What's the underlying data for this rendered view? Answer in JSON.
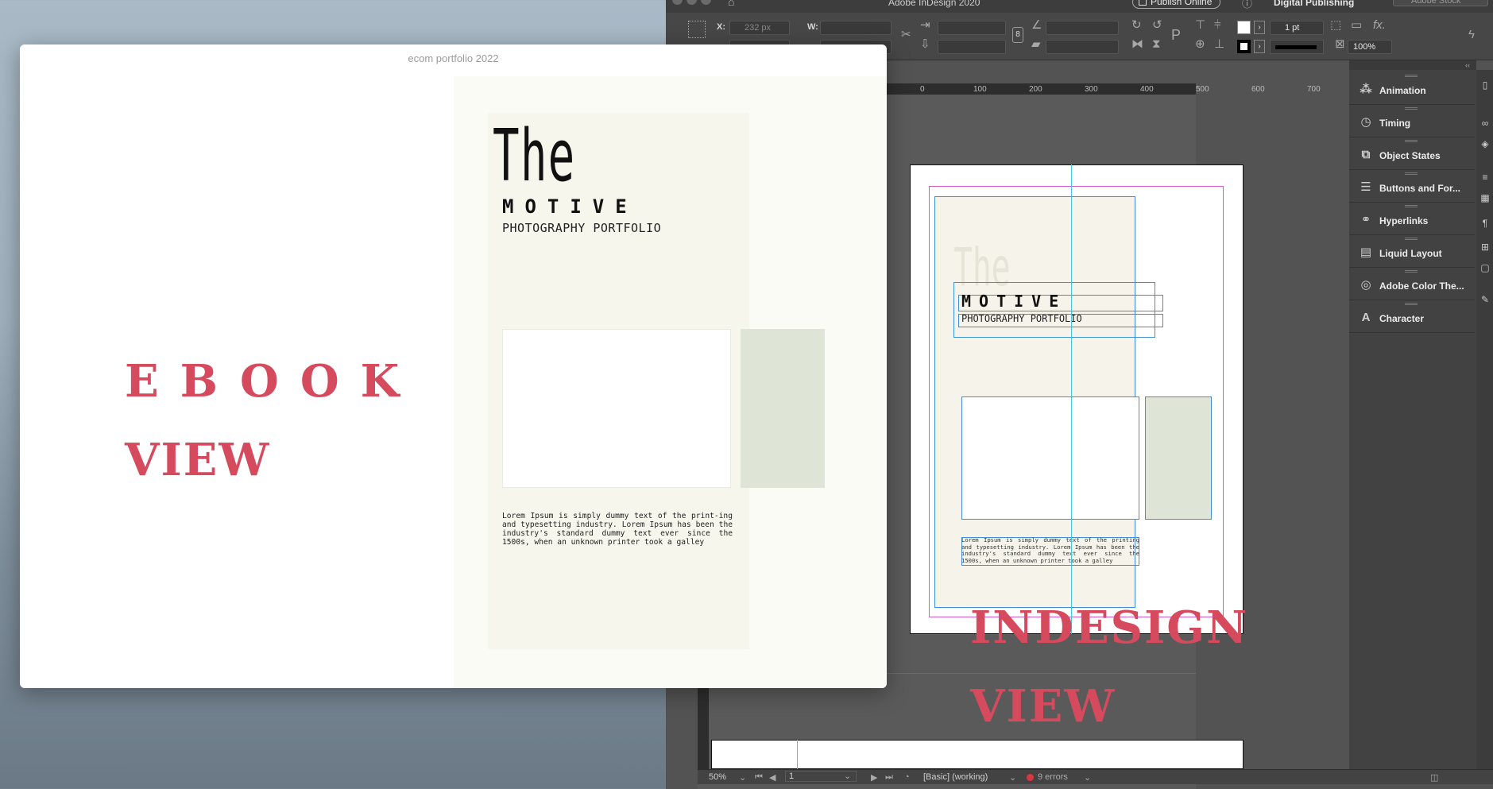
{
  "indesign": {
    "app_title": "Adobe InDesign 2020",
    "publish_label": "Publish Online",
    "workspace": "Digital Publishing",
    "search_placeholder": "Adobe Stock",
    "control": {
      "x_label": "X:",
      "x_value": "232 px",
      "w_label": "W:",
      "stroke_weight": "1 pt",
      "opacity": "100%",
      "fx_label": "fx."
    },
    "ruler_ticks": [
      "0",
      "100",
      "200",
      "300",
      "400",
      "500",
      "600",
      "700"
    ],
    "panels": [
      {
        "icon": "animation-icon",
        "label": "Animation"
      },
      {
        "icon": "timing-icon",
        "label": "Timing"
      },
      {
        "icon": "object-states-icon",
        "label": "Object States"
      },
      {
        "icon": "buttons-forms-icon",
        "label": "Buttons and For..."
      },
      {
        "icon": "hyperlinks-icon",
        "label": "Hyperlinks"
      },
      {
        "icon": "liquid-layout-icon",
        "label": "Liquid Layout"
      },
      {
        "icon": "adobe-color-themes-icon",
        "label": "Adobe Color The..."
      },
      {
        "icon": "character-icon",
        "label": "Character"
      }
    ],
    "page_content": {
      "the": "The",
      "motive": "MOTIVE",
      "subtitle": "PHOTOGRAPHY PORTFOLIO",
      "lorem": "Lorem Ipsum is simply dummy text of the printing and typesetting industry. Lorem Ipsum has been the industry's standard dummy text ever since the 1500s, when an unknown printer took a galley"
    },
    "status": {
      "zoom": "50%",
      "page": "1",
      "profile": "[Basic] (working)",
      "errors": "9 errors"
    },
    "colors": {
      "guide": "#42c7e0",
      "margin": "#d45bd0",
      "frame": "#3f8fd6",
      "error": "#d9363e"
    }
  },
  "ebook": {
    "window_title": "ecom portfolio 2022",
    "the": "The",
    "motive": "MOTIVE",
    "subtitle": "PHOTOGRAPHY PORTFOLIO",
    "lorem": "Lorem Ipsum is simply dummy text of the print-ing and typesetting industry. Lorem Ipsum has been the industry's standard dummy text ever since the 1500s, when an unknown printer took a galley",
    "accent_color": "#dfe5d6"
  },
  "callouts": {
    "ebook": "EBOOK",
    "ebook_view": "VIEW",
    "indesign": "INDESIGN",
    "indesign_view": "VIEW",
    "color": "#d64a5e"
  }
}
